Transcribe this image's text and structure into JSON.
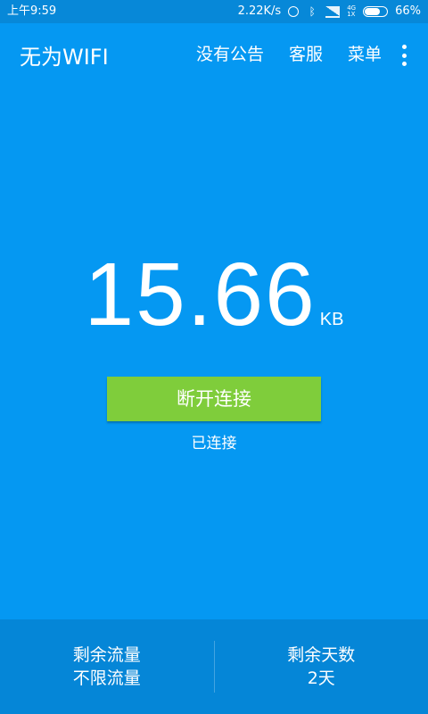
{
  "status_bar": {
    "time": "上午9:59",
    "net_speed": "2.22K/s",
    "net_type_top": "4G",
    "net_type_bottom": "1X",
    "battery": "66%"
  },
  "app_bar": {
    "title": "无为WIFI",
    "menu": [
      "没有公告",
      "客服",
      "菜单"
    ]
  },
  "usage": {
    "value": "15.66",
    "unit": "KB"
  },
  "actions": {
    "disconnect_label": "断开连接",
    "status": "已连接"
  },
  "footer": {
    "left_label": "剩余流量",
    "left_value": "不限流量",
    "right_label": "剩余天数",
    "right_value": "2天"
  },
  "colors": {
    "background": "#0598f2",
    "status_bar": "#0788d8",
    "button": "#7fcd3b",
    "footer": "#0586d7"
  }
}
